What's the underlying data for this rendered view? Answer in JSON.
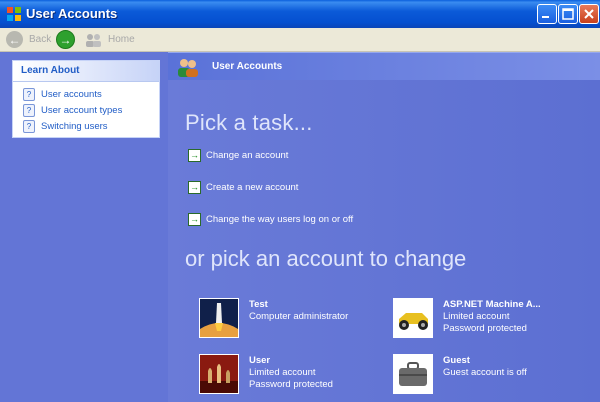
{
  "window": {
    "title": "User Accounts"
  },
  "toolbar": {
    "back_label": "Back",
    "home_label": "Home"
  },
  "learn_about": {
    "title": "Learn About",
    "items": [
      {
        "label": "User accounts"
      },
      {
        "label": "User account types"
      },
      {
        "label": "Switching users"
      }
    ]
  },
  "header": {
    "title": "User Accounts"
  },
  "main": {
    "pick_task_title": "Pick a task...",
    "tasks": [
      {
        "label": "Change an account"
      },
      {
        "label": "Create a new account"
      },
      {
        "label": "Change the way users log on or off"
      }
    ],
    "pick_account_title": "or pick an account to change",
    "accounts": [
      {
        "name": "Test",
        "line1": "Computer administrator",
        "line2": "",
        "picture": "space-shuttle"
      },
      {
        "name": "ASP.NET Machine A...",
        "line1": "Limited account",
        "line2": "Password protected",
        "picture": "race-car"
      },
      {
        "name": "User",
        "line1": "Limited account",
        "line2": "Password protected",
        "picture": "chess-pieces"
      },
      {
        "name": "Guest",
        "line1": "Guest account is off",
        "line2": "",
        "picture": "briefcase"
      }
    ]
  },
  "colors": {
    "background": "#6375d6",
    "titlebar": "#0550d0",
    "link": "#215dc6"
  }
}
